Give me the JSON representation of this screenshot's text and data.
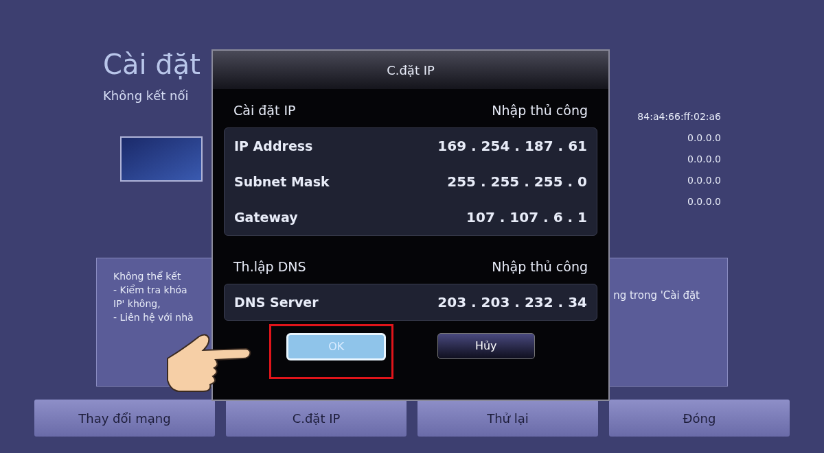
{
  "page": {
    "title": "Cài đặt",
    "subtitle": "Không kết nối",
    "info_values": [
      "84:a4:66:ff:02:a6",
      "0.0.0.0",
      "0.0.0.0",
      "0.0.0.0",
      "0.0.0.0"
    ],
    "message_left": [
      "Không thể kết",
      "- Kiểm tra khóa",
      "IP' không,",
      "- Liên hệ với nhà"
    ],
    "message_right": "ng trong 'Cài đặt"
  },
  "dialog": {
    "title": "C.đặt IP",
    "sections": [
      {
        "label": "Cài đặt IP",
        "value": "Nhập thủ công",
        "fields": [
          {
            "label": "IP Address",
            "value": "169 . 254 . 187 . 61"
          },
          {
            "label": "Subnet Mask",
            "value": "255 . 255 . 255 . 0"
          },
          {
            "label": "Gateway",
            "value": "107 . 107 . 6 . 1"
          }
        ]
      },
      {
        "label": "Th.lập DNS",
        "value": "Nhập thủ công",
        "fields": [
          {
            "label": "DNS Server",
            "value": "203 . 203 . 232 . 34"
          }
        ]
      }
    ],
    "buttons": [
      {
        "label": "OK",
        "selected": true
      },
      {
        "label": "Hủy",
        "selected": false
      }
    ]
  },
  "bottom_buttons": [
    "Thay đổi mạng",
    "C.đặt IP",
    "Thử lại",
    "Đóng"
  ]
}
